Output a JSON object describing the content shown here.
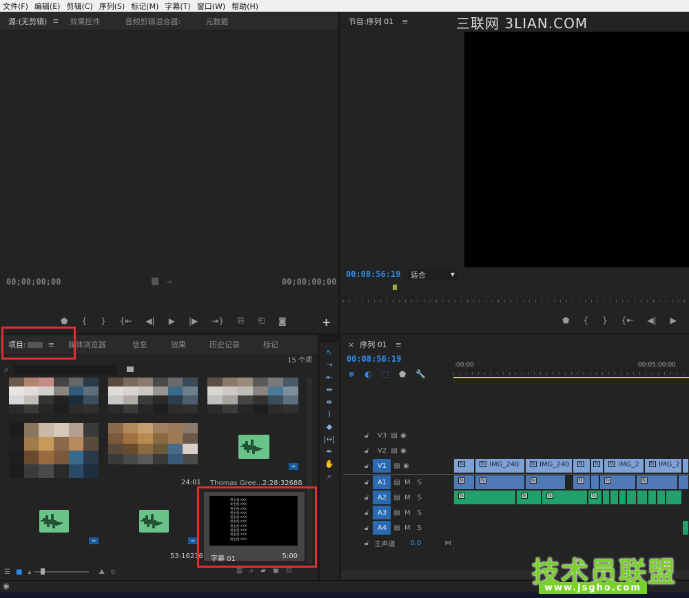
{
  "menu": [
    "文件(F)",
    "编辑(E)",
    "剪辑(C)",
    "序列(S)",
    "标记(M)",
    "字幕(T)",
    "窗口(W)",
    "帮助(H)"
  ],
  "source_panel": {
    "tabs": [
      "源:(无剪辑)",
      "效果控件",
      "音频剪辑混合器:",
      "元数据"
    ],
    "timecode_left": "00;00;00;00",
    "timecode_right": "00;00;00;00"
  },
  "program_panel": {
    "tab": "节目:序列 01",
    "timecode": "00:08:56:19",
    "fit": "适合"
  },
  "project_panel": {
    "tabs": [
      "项目:",
      "媒体浏览器",
      "信息",
      "效果",
      "历史记录",
      "标记"
    ],
    "count": "15 个项",
    "items": [
      {
        "label": "",
        "duration": "24:01"
      },
      {
        "label": "Thomas Gree...",
        "duration": "2:28:32688"
      },
      {
        "label": "",
        "duration": "53:16236"
      },
      {
        "label": "字幕 01",
        "duration": "5:00"
      }
    ],
    "title_lines": [
      "男主角:XXX",
      "女主角:XXX",
      "男主角:XXX",
      "男主角:XXX",
      "男主角:XXX",
      "男主角:XXX",
      "男主角:XXX",
      "男主角:XXX",
      "男主角:XXX",
      "男主角:XXX"
    ]
  },
  "timeline": {
    "tab": "序列 01",
    "timecode": "00:08:56:19",
    "ruler": [
      ":00:00",
      "00:05:00:00"
    ],
    "tracks": [
      {
        "name": "V3",
        "selected": false,
        "type": "video"
      },
      {
        "name": "V2",
        "selected": false,
        "type": "video"
      },
      {
        "name": "V1",
        "selected": true,
        "type": "video"
      },
      {
        "name": "A1",
        "selected": true,
        "type": "audio"
      },
      {
        "name": "A2",
        "selected": true,
        "type": "audio"
      },
      {
        "name": "A3",
        "selected": true,
        "type": "audio"
      },
      {
        "name": "A4",
        "selected": true,
        "type": "audio"
      }
    ],
    "master": {
      "label": "主声道",
      "value": "0.0"
    },
    "clip_labels": [
      "IMG_240",
      "IMG_240",
      "IMG_2",
      "IMG_2"
    ]
  },
  "watermarks": {
    "top": "三联网 3LIAN.COM",
    "bottom_main": "技术员联盟",
    "bottom_url": "www.jsgho.com"
  },
  "colors": {
    "accent": "#2d8ceb",
    "highlight_box": "#e0302b"
  }
}
